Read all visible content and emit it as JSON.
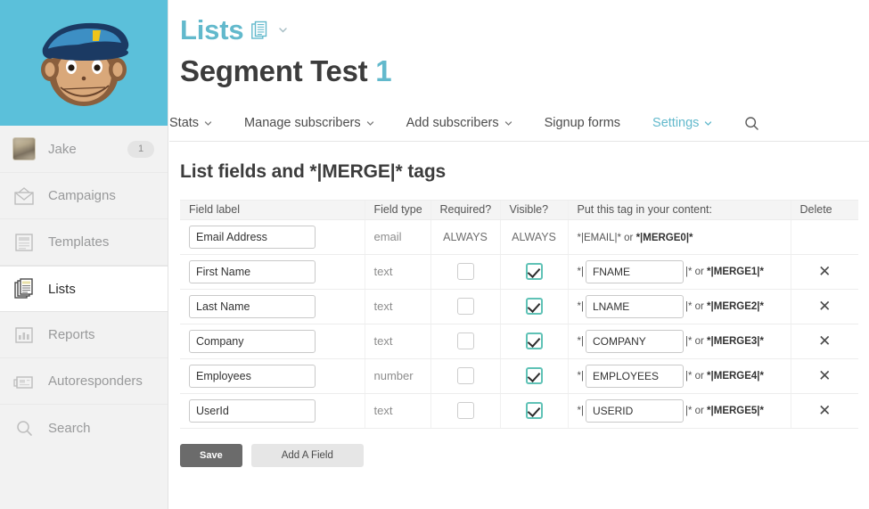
{
  "sidebar": {
    "logo_alt": "mailchimp-freddie-logo",
    "items": [
      {
        "label": "Jake",
        "icon": "user-avatar",
        "badge": "1",
        "active": false
      },
      {
        "label": "Campaigns",
        "icon": "envelope-icon",
        "badge": "",
        "active": false
      },
      {
        "label": "Templates",
        "icon": "template-icon",
        "badge": "",
        "active": false
      },
      {
        "label": "Lists",
        "icon": "lists-icon",
        "badge": "",
        "active": true
      },
      {
        "label": "Reports",
        "icon": "bar-chart-icon",
        "badge": "",
        "active": false
      },
      {
        "label": "Autoresponders",
        "icon": "autoresponder-icon",
        "badge": "",
        "active": false
      },
      {
        "label": "Search",
        "icon": "search-icon",
        "badge": "",
        "active": false
      }
    ]
  },
  "header": {
    "breadcrumb": "Lists",
    "breadcrumb_icon": "lists-icon",
    "dropdown_icon": "chevron-down-icon",
    "title": "Segment Test",
    "title_number": "1"
  },
  "tabs": [
    {
      "label": "Stats",
      "has_caret": true,
      "accent": false
    },
    {
      "label": "Manage subscribers",
      "has_caret": true,
      "accent": false
    },
    {
      "label": "Add subscribers",
      "has_caret": true,
      "accent": false
    },
    {
      "label": "Signup forms",
      "has_caret": false,
      "accent": false
    },
    {
      "label": "Settings",
      "has_caret": true,
      "accent": true
    }
  ],
  "tab_search_icon": "search-icon",
  "section": {
    "title": "List fields and *|MERGE|* tags"
  },
  "table": {
    "columns": [
      "Field label",
      "Field type",
      "Required?",
      "Visible?",
      "Put this tag in your content:",
      "Delete"
    ],
    "rows": [
      {
        "field_label": "Email Address",
        "field_type": "email",
        "required_text": "ALWAYS",
        "required_checkbox": null,
        "visible_text": "ALWAYS",
        "visible_checkbox": null,
        "tag_static": "*|EMAIL|* or *|MERGE0|*",
        "tag_prefix": "",
        "tag_value": "",
        "tag_suffix": "",
        "deletable": false,
        "delete_icon": ""
      },
      {
        "field_label": "First Name",
        "field_type": "text",
        "required_text": "",
        "required_checkbox": false,
        "visible_text": "",
        "visible_checkbox": true,
        "tag_static": "",
        "tag_prefix": "*|",
        "tag_value": "FNAME",
        "tag_suffix": "|* or *|MERGE1|*",
        "deletable": true,
        "delete_icon": "✕"
      },
      {
        "field_label": "Last Name",
        "field_type": "text",
        "required_text": "",
        "required_checkbox": false,
        "visible_text": "",
        "visible_checkbox": true,
        "tag_static": "",
        "tag_prefix": "*|",
        "tag_value": "LNAME",
        "tag_suffix": "|* or *|MERGE2|*",
        "deletable": true,
        "delete_icon": "✕"
      },
      {
        "field_label": "Company",
        "field_type": "text",
        "required_text": "",
        "required_checkbox": false,
        "visible_text": "",
        "visible_checkbox": true,
        "tag_static": "",
        "tag_prefix": "*|",
        "tag_value": "COMPANY",
        "tag_suffix": "|* or *|MERGE3|*",
        "deletable": true,
        "delete_icon": "✕"
      },
      {
        "field_label": "Employees",
        "field_type": "number",
        "required_text": "",
        "required_checkbox": false,
        "visible_text": "",
        "visible_checkbox": true,
        "tag_static": "",
        "tag_prefix": "*|",
        "tag_value": "EMPLOYEES",
        "tag_suffix": "|* or *|MERGE4|*",
        "deletable": true,
        "delete_icon": "✕"
      },
      {
        "field_label": "UserId",
        "field_type": "text",
        "required_text": "",
        "required_checkbox": false,
        "visible_text": "",
        "visible_checkbox": true,
        "tag_static": "",
        "tag_prefix": "*|",
        "tag_value": "USERID",
        "tag_suffix": "|* or *|MERGE5|*",
        "deletable": true,
        "delete_icon": "✕"
      }
    ]
  },
  "footer": {
    "save_label": "Save",
    "add_field_label": "Add A Field"
  },
  "colors": {
    "accent_teal": "#62b9cc",
    "logo_background": "#5bc0da",
    "checkbox_checked_border": "#5fc2b6",
    "save_button": "#6b6b6b",
    "sidebar_background": "#f2f2f2"
  }
}
